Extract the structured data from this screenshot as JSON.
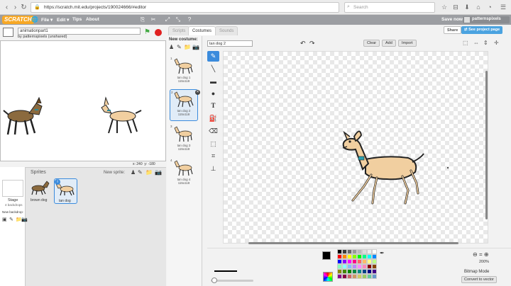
{
  "browser": {
    "url": "https://scratch.mit.edu/projects/190024666/#editor",
    "search_placeholder": "Search"
  },
  "menu": {
    "logo": "SCRATCH",
    "file": "File ▾",
    "edit": "Edit ▾",
    "tips": "Tips",
    "about": "About",
    "save_now": "Save now",
    "username": "patternspixels"
  },
  "project": {
    "title": "animationpart1",
    "author": "by patternspixels (unshared)",
    "share": "Share",
    "see_project_page": "See project page"
  },
  "stage": {
    "x_label": "x:",
    "x_value": "240",
    "y_label": "y:",
    "y_value": "-180"
  },
  "sprites_panel": {
    "title": "Sprites",
    "new_sprite": "New sprite:",
    "stage_label": "Stage",
    "stage_backdrops": "4 backdrops",
    "new_backdrop": "New backdrop:",
    "sprites": [
      {
        "name": "brown dog",
        "color": "#8b6a3e"
      },
      {
        "name": "tan dog",
        "color": "#f1cfa0",
        "selected": true,
        "info": "i"
      }
    ]
  },
  "tabs": [
    "Scripts",
    "Costumes",
    "Sounds"
  ],
  "costumes": {
    "new_costume": "New costume:",
    "items": [
      {
        "num": "1",
        "name": "tan dog 1",
        "size": "115x118"
      },
      {
        "num": "2",
        "name": "tan dog 2",
        "size": "115x118",
        "selected": true
      },
      {
        "num": "3",
        "name": "tan dog 3",
        "size": "115x118"
      },
      {
        "num": "4",
        "name": "tan dog 4",
        "size": "115x118"
      }
    ]
  },
  "editor": {
    "costume_name": "tan dog 2",
    "clear": "Clear",
    "add": "Add",
    "import": "Import",
    "zoom_level": "200%",
    "mode": "Bitmap Mode",
    "convert": "Convert to vector",
    "tools": [
      "brush-icon",
      "line-icon",
      "rectangle-icon",
      "ellipse-icon",
      "text-icon",
      "fill-icon",
      "eraser-icon",
      "select-icon",
      "select-remove-bg-icon",
      "stamp-icon"
    ],
    "palette": [
      "#000000",
      "#3a3a3a",
      "#666666",
      "#999999",
      "#bbbbbb",
      "#dddddd",
      "#eeeeee",
      "#ffffff",
      "#ff0000",
      "#ff8800",
      "#ffff00",
      "#88ff00",
      "#00ff00",
      "#00ff88",
      "#00ffff",
      "#0088ff",
      "#0000ff",
      "#8800ff",
      "#ff00ff",
      "#ff0088",
      "#ff6666",
      "#ffbb66",
      "#ffff88",
      "#bbff88",
      "#88ffbb",
      "#88ffff",
      "#88bbff",
      "#bb88ff",
      "#ff88ff",
      "#ff88bb",
      "#880000",
      "#884400",
      "#888800",
      "#448800",
      "#008800",
      "#008844",
      "#008888",
      "#004488",
      "#000088",
      "#440088",
      "#880088",
      "#880044",
      "#cc6666",
      "#cc9966",
      "#cccc66",
      "#99cc66",
      "#66cc99",
      "#6699cc"
    ]
  }
}
